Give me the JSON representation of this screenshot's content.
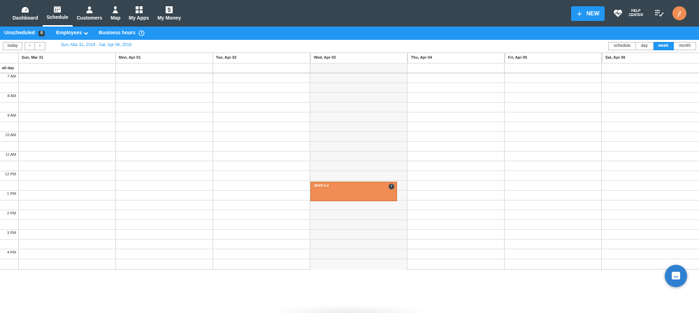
{
  "nav": {
    "items": [
      {
        "label": "Dashboard",
        "icon": "dashboard-icon"
      },
      {
        "label": "Schedule",
        "icon": "calendar-icon"
      },
      {
        "label": "Customers",
        "icon": "customers-icon"
      },
      {
        "label": "Map",
        "icon": "map-icon"
      },
      {
        "label": "My Apps",
        "icon": "apps-icon"
      },
      {
        "label": "My Money",
        "icon": "money-icon"
      }
    ],
    "active": "Schedule",
    "new_label": "NEW",
    "help_line1": "HELP",
    "help_line2": "CENTER",
    "avatar_initials": "jl"
  },
  "subbar": {
    "unscheduled_label": "Unscheduled",
    "unscheduled_count": "0",
    "employees_label": "Employees",
    "business_hours_label": "Business hours"
  },
  "toolbar": {
    "today_label": "today",
    "prev_label": "‹",
    "next_label": "›",
    "date_range": "Sun, Mar 31, 2019 - Sat, Apr 06, 2019",
    "views": [
      "schedule",
      "day",
      "week",
      "month"
    ],
    "active_view": "week"
  },
  "calendar": {
    "days": [
      "Sun, Mar 31",
      "Mon, Apr 01",
      "Tue, Apr 02",
      "Wed, Apr 03",
      "Thu, Apr 04",
      "Fri, Apr 05",
      "Sat, Apr 06"
    ],
    "today_index": 3,
    "all_day_label": "all day",
    "times": [
      "7 AM",
      "8 AM",
      "9 AM",
      "10 AM",
      "11 AM",
      "12 PM",
      "1 PM",
      "2 PM",
      "3 PM",
      "4 PM"
    ],
    "event": {
      "title": "Josh Lu",
      "info_icon": "i"
    }
  },
  "colors": {
    "topbar": "#36454f",
    "accent": "#2196f3",
    "event": "#ef8d54"
  }
}
